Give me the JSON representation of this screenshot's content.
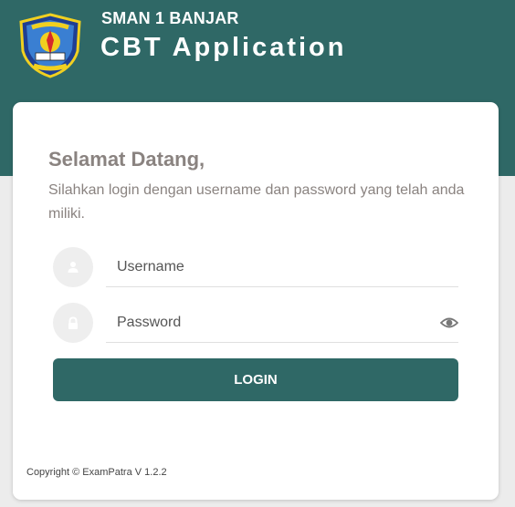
{
  "header": {
    "school_name": "SMAN 1 BANJAR",
    "app_title": "CBT Application",
    "logo_icon": "school-emblem-icon",
    "background_color": "#2f6866"
  },
  "login": {
    "greeting": "Selamat Datang,",
    "instruction": "Silahkan login dengan username dan password yang telah anda miliki.",
    "username": {
      "placeholder": "Username",
      "value": "",
      "icon": "user-icon"
    },
    "password": {
      "placeholder": "Password",
      "value": "",
      "icon": "lock-icon",
      "toggle_icon": "eye-icon"
    },
    "submit_label": "LOGIN",
    "button_color": "#2f6866"
  },
  "footer": {
    "copyright": "Copyright © ExamPatra V 1.2.2"
  }
}
